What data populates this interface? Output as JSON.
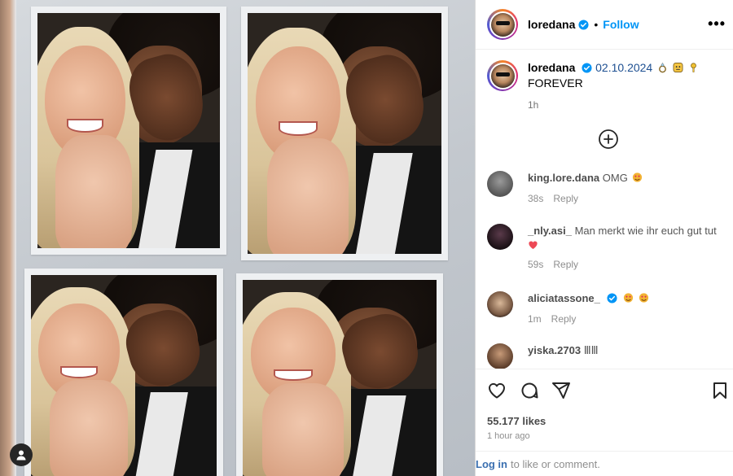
{
  "post": {
    "username": "loredana",
    "follow_label": "Follow",
    "separator": "•",
    "more_label": "•••"
  },
  "caption": {
    "username": "loredana",
    "date": "02.10.2024",
    "text": "FOREVER",
    "time": "1h"
  },
  "comments": [
    {
      "user": "king.lore.dana",
      "text": "OMG",
      "time": "38s",
      "reply": "Reply"
    },
    {
      "user": "_nly.asi_",
      "text": "Man merkt wie ihr euch gut tut",
      "time": "59s",
      "reply": "Reply"
    },
    {
      "user": "aliciatassone_",
      "text": "",
      "time": "1m",
      "reply": "Reply"
    },
    {
      "user": "yiska.2703",
      "text": "ⅢⅢ",
      "time": "",
      "reply": ""
    }
  ],
  "stats": {
    "likes": "55.177 likes",
    "ago": "1 hour ago"
  },
  "login": {
    "link": "Log in",
    "rest": "to like or comment."
  },
  "colors": {
    "accent": "#0095f6",
    "verified": "#0095f6",
    "date_link": "#1d4f91",
    "heart": "#ed4956"
  },
  "icons": [
    "verified-icon",
    "more-options-icon",
    "add-circle-icon",
    "heart-icon",
    "comment-icon",
    "share-icon",
    "bookmark-icon",
    "person-icon"
  ]
}
